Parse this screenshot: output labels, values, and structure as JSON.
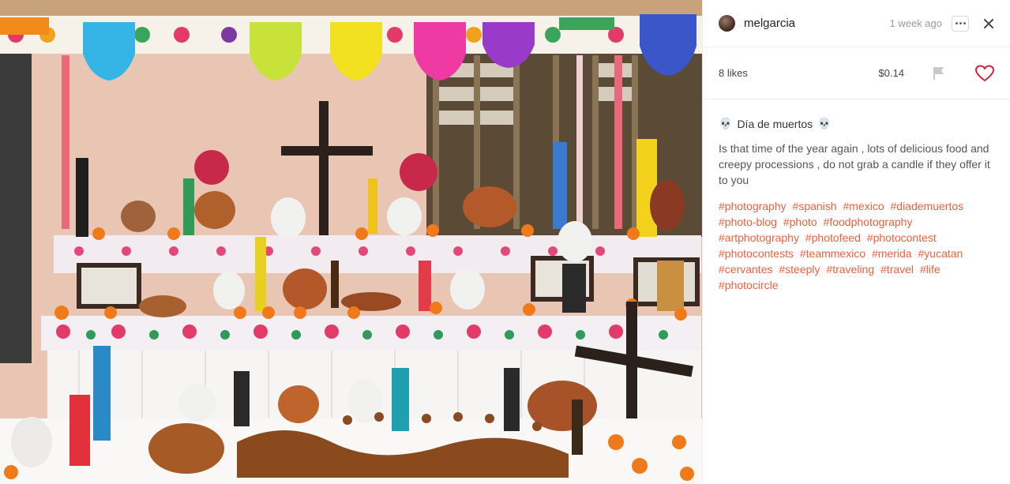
{
  "photo": {
    "alt_subject": "altar"
  },
  "post": {
    "username": "melgarcia",
    "time_ago": "1 week ago",
    "likes": "8 likes",
    "payout": "$0.14",
    "title_icon": "skull-icon",
    "title": "Día de muertos",
    "title_prefix": "💀",
    "title_suffix": "💀",
    "body": "Is that time of the year again , lots of delicious food and creepy processions , do not grab a candle if they offer it to you",
    "tags": [
      "#photography",
      "#spanish",
      "#mexico",
      "#diademuertos",
      "#photo-blog",
      "#photo",
      "#foodphotography",
      "#artphotography",
      "#photofeed",
      "#photocontest",
      "#photocontests",
      "#teammexico",
      "#merida",
      "#yucatan",
      "#cervantes",
      "#steeply",
      "#traveling",
      "#travel",
      "#life",
      "#photocircle"
    ]
  },
  "colors": {
    "accent": "#e8623d",
    "heart": "#d0233a"
  }
}
